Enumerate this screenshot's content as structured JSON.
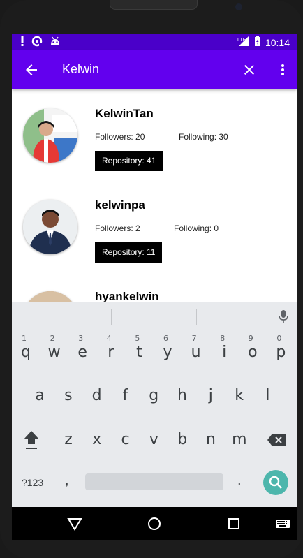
{
  "status_bar": {
    "time": "10:14",
    "network": "LTE",
    "icons": [
      "alert-icon",
      "sync-icon",
      "android-icon",
      "signal-icon",
      "battery-charging-icon"
    ]
  },
  "app_bar": {
    "search_query": "Kelwin",
    "icons": [
      "back-arrow-icon",
      "close-icon",
      "more-vert-icon"
    ],
    "color": "#6200ee"
  },
  "users": [
    {
      "username": "KelwinTan",
      "followers": "Followers: 20",
      "following": "Following: 30",
      "repository": "Repository: 41"
    },
    {
      "username": "kelwinpa",
      "followers": "Followers: 2",
      "following": "Following: 0",
      "repository": "Repository: 11"
    },
    {
      "username": "hyankelwin",
      "followers": "",
      "following": "",
      "repository": ""
    }
  ],
  "keyboard": {
    "row1": [
      "q",
      "w",
      "e",
      "r",
      "t",
      "y",
      "u",
      "i",
      "o",
      "p"
    ],
    "row1_hints": [
      "1",
      "2",
      "3",
      "4",
      "5",
      "6",
      "7",
      "8",
      "9",
      "0"
    ],
    "row2": [
      "a",
      "s",
      "d",
      "f",
      "g",
      "h",
      "j",
      "k",
      "l"
    ],
    "row3": [
      "z",
      "x",
      "c",
      "v",
      "b",
      "n",
      "m"
    ],
    "symbols_key": "?123",
    "comma": ",",
    "period": ".",
    "accent": "#4db6ac"
  },
  "nav_bar": {
    "icons": [
      "back-triangle-icon",
      "home-circle-icon",
      "recents-square-icon",
      "keyboard-icon"
    ]
  }
}
